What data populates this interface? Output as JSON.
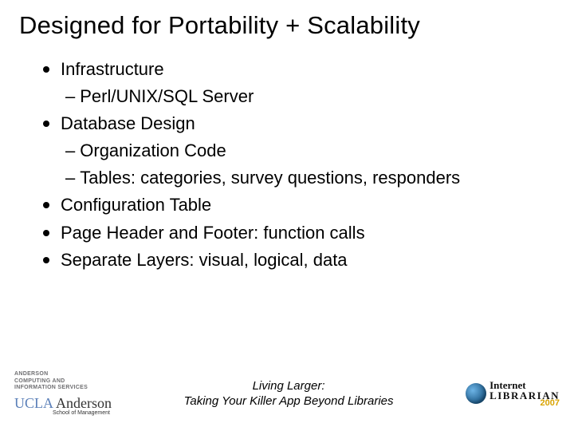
{
  "title": "Designed for Portability + Scalability",
  "bullets": [
    {
      "text": "Infrastructure",
      "subs": [
        "Perl/UNIX/SQL Server"
      ]
    },
    {
      "text": "Database Design",
      "subs": [
        "Organization Code",
        "Tables: categories, survey questions, responders"
      ]
    },
    {
      "text": "Configuration Table",
      "subs": []
    },
    {
      "text": "Page Header and Footer:  function calls",
      "subs": []
    },
    {
      "text": "Separate Layers:  visual, logical, data",
      "subs": []
    }
  ],
  "footer": {
    "acis_line1": "ANDERSON",
    "acis_line2": "COMPUTING AND",
    "acis_line3": "INFORMATION SERVICES",
    "ucla_main": "UCLA",
    "ucla_brand": "Anderson",
    "ucla_sub": "School of Management",
    "caption_line1": "Living Larger:",
    "caption_line2": "Taking Your Killer App Beyond Libraries",
    "conf_top": "Internet",
    "conf_bottom": "LIBRARIAN",
    "conf_year": "2007"
  }
}
